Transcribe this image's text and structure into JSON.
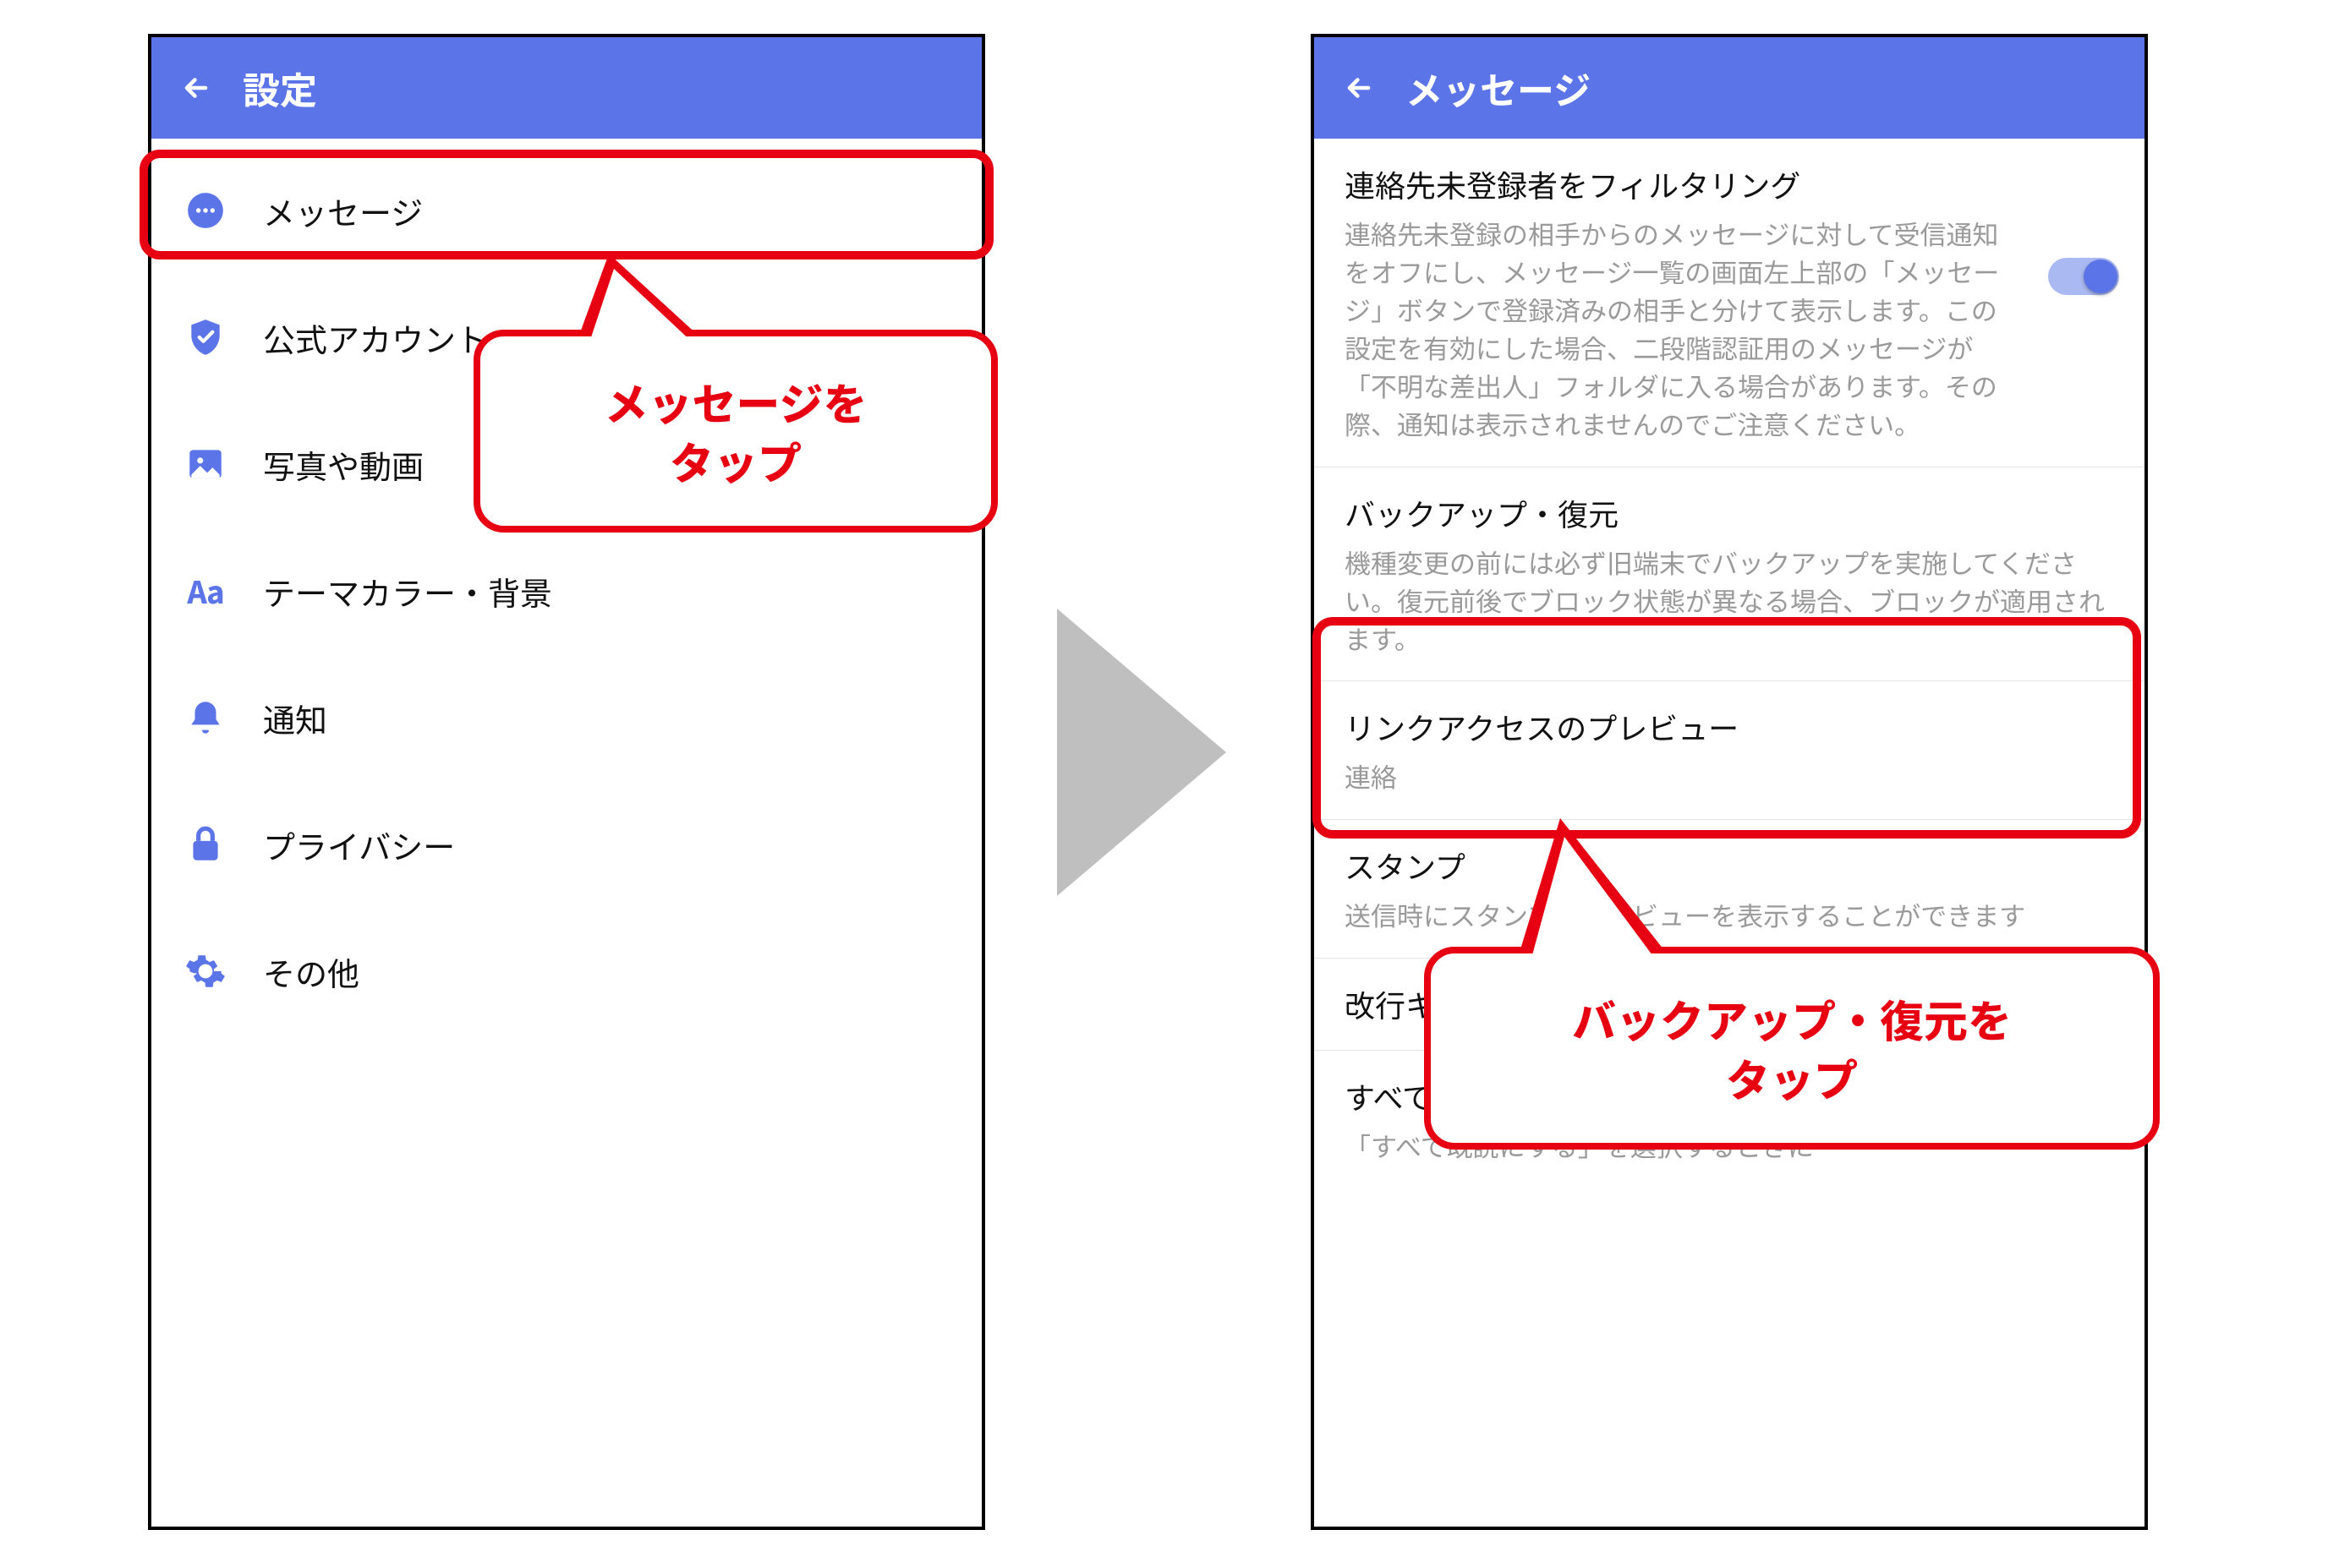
{
  "colors": {
    "accent": "#5b74e8",
    "highlight": "#e60012"
  },
  "left": {
    "title": "設定",
    "items": [
      {
        "label": "メッセージ",
        "icon": "chat-bubble-icon"
      },
      {
        "label": "公式アカウント",
        "icon": "shield-check-icon"
      },
      {
        "label": "写真や動画",
        "icon": "image-icon"
      },
      {
        "label": "テーマカラー・背景",
        "icon": "aa-icon"
      },
      {
        "label": "通知",
        "icon": "bell-icon"
      },
      {
        "label": "プライバシー",
        "icon": "lock-icon"
      },
      {
        "label": "その他",
        "icon": "gear-icon"
      }
    ]
  },
  "right": {
    "title": "メッセージ",
    "filter": {
      "title": "連絡先未登録者をフィルタリング",
      "desc": "連絡先未登録の相手からのメッセージに対して受信通知をオフにし、メッセージ一覧の画面左上部の「メッセージ」ボタンで登録済みの相手と分けて表示します。この設定を有効にした場合、二段階認証用のメッセージが「不明な差出人」フォルダに入る場合があります。その際、通知は表示されませんのでご注意ください。",
      "on": true
    },
    "backup": {
      "title": "バックアップ・復元",
      "desc": "機種変更の前には必ず旧端末でバックアップを実施してください。復元前後でブロック状態が異なる場合、ブロックが適用されます。"
    },
    "linkpreview": {
      "title": "リンクアクセスのプレビュー",
      "desc_prefix": "連絡"
    },
    "stamp": {
      "title": "スタンプ",
      "desc": "送信時にスタンプのプレビューを表示することができます"
    },
    "enter_send": {
      "title": "改行キーでメッセージを送信",
      "on": false
    },
    "mark_read": {
      "title": "すべて既読にする際の確認",
      "desc": "「すべて既読にする」を選択するときに",
      "on": true
    }
  },
  "callouts": {
    "c1": "メッセージを\nタップ",
    "c2": "バックアップ・復元を\nタップ"
  }
}
